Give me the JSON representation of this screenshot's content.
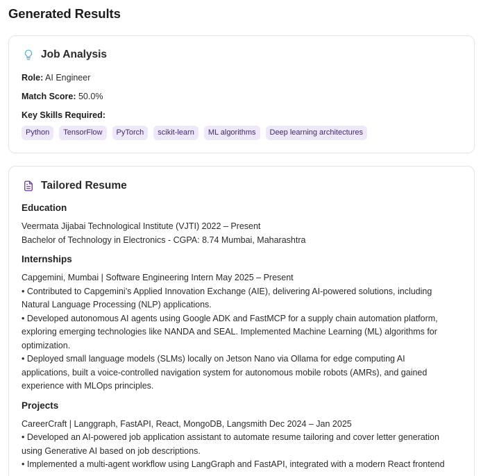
{
  "page": {
    "title": "Generated Results"
  },
  "analysis": {
    "title": "Job Analysis",
    "icon": "lightbulb-icon",
    "role_label": "Role:",
    "role_value": "AI Engineer",
    "score_label": "Match Score:",
    "score_value": "50.0%",
    "skills_label": "Key Skills Required:",
    "skills": [
      "Python",
      "TensorFlow",
      "PyTorch",
      "scikit-learn",
      "ML algorithms",
      "Deep learning architectures"
    ]
  },
  "resume": {
    "title": "Tailored Resume",
    "icon": "document-icon",
    "sections": [
      {
        "heading": "Education",
        "lines": [
          "Veermata Jijabai Technological Institute (VJTI) 2022 – Present",
          "Bachelor of Technology in Electronics - CGPA: 8.74 Mumbai, Maharashtra"
        ]
      },
      {
        "heading": "Internships",
        "lines": [
          "Capgemini, Mumbai | Software Engineering Intern May 2025 – Present",
          "• Contributed to Capgemini’s Applied Innovation Exchange (AIE), delivering AI-powered solutions, including",
          "Natural Language Processing (NLP) applications.",
          "• Developed autonomous AI agents using Google ADK and FastMCP for a supply chain automation platform,",
          "exploring emerging technologies like NANDA and SEAL. Implemented Machine Learning (ML) algorithms for",
          "optimization.",
          "• Deployed small language models (SLMs) locally on Jetson Nano via Ollama for edge computing AI",
          "applications, built a voice-controlled navigation system for autonomous mobile robots (AMRs), and gained",
          "experience with MLOps principles."
        ]
      },
      {
        "heading": "Projects",
        "lines": [
          "CareerCraft | Langgraph, FastAPI, React, MongoDB, Langsmith Dec 2024 – Jan 2025",
          "• Developed an AI-powered job application assistant to automate resume tailoring and cover letter generation",
          "using Generative AI based on job descriptions.",
          "• Implemented a multi-agent workflow using LangGraph and FastAPI, integrated with a modern React frontend"
        ]
      }
    ]
  }
}
